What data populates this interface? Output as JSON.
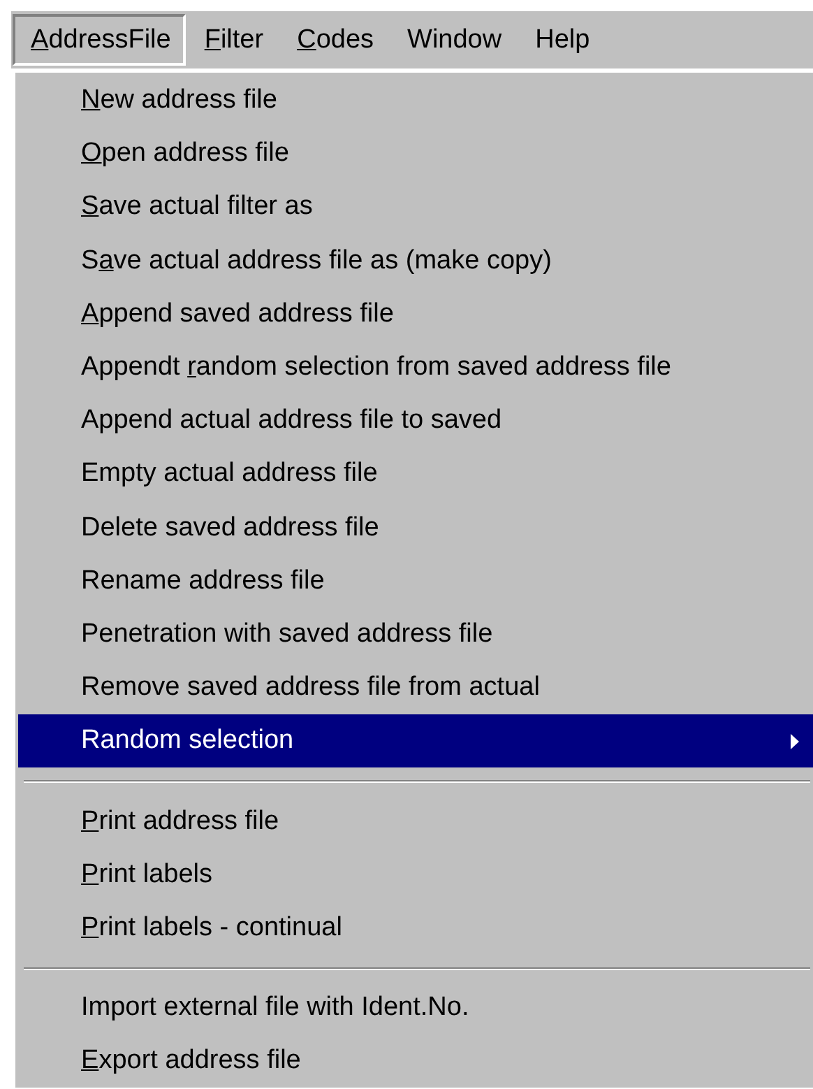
{
  "menubar": [
    {
      "label": {
        "key": "A",
        "post": "ddressFile"
      },
      "selected": true
    },
    {
      "label": {
        "key": "F",
        "post": "ilter"
      },
      "selected": false
    },
    {
      "label": {
        "key": "C",
        "post": "odes"
      },
      "selected": false
    },
    {
      "label": {
        "pre": "Window"
      },
      "selected": false
    },
    {
      "label": {
        "pre": "Help"
      },
      "selected": false
    }
  ],
  "menu": [
    {
      "kind": "item",
      "label": {
        "key": "N",
        "post": "ew address file"
      },
      "selected": false,
      "has_submenu": false
    },
    {
      "kind": "item",
      "label": {
        "key": "O",
        "post": "pen address file"
      },
      "selected": false,
      "has_submenu": false
    },
    {
      "kind": "item",
      "label": {
        "key": "S",
        "post": "ave actual filter as"
      },
      "selected": false,
      "has_submenu": false
    },
    {
      "kind": "item",
      "label": {
        "pre": "S",
        "key": "a",
        "post": "ve actual address file as (make copy)"
      },
      "selected": false,
      "has_submenu": false
    },
    {
      "kind": "item",
      "label": {
        "key": "A",
        "post": "ppend saved address file"
      },
      "selected": false,
      "has_submenu": false
    },
    {
      "kind": "item",
      "label": {
        "pre": "Appendt ",
        "key": "r",
        "post": "andom selection from saved address file"
      },
      "selected": false,
      "has_submenu": false
    },
    {
      "kind": "item",
      "label": {
        "pre": "Append actual address file to saved"
      },
      "selected": false,
      "has_submenu": false
    },
    {
      "kind": "item",
      "label": {
        "pre": "Empty actual address file"
      },
      "selected": false,
      "has_submenu": false
    },
    {
      "kind": "item",
      "label": {
        "pre": "Delete saved address file"
      },
      "selected": false,
      "has_submenu": false
    },
    {
      "kind": "item",
      "label": {
        "pre": "Rename address file"
      },
      "selected": false,
      "has_submenu": false
    },
    {
      "kind": "item",
      "label": {
        "pre": "Penetration with saved address file"
      },
      "selected": false,
      "has_submenu": false
    },
    {
      "kind": "item",
      "label": {
        "pre": "Remove saved address file from actual"
      },
      "selected": false,
      "has_submenu": false
    },
    {
      "kind": "item",
      "label": {
        "pre": "Random selection"
      },
      "selected": true,
      "has_submenu": true
    },
    {
      "kind": "separator"
    },
    {
      "kind": "item",
      "label": {
        "key": "P",
        "post": "rint address file"
      },
      "selected": false,
      "has_submenu": false
    },
    {
      "kind": "item",
      "label": {
        "key": "P",
        "post": "rint labels"
      },
      "selected": false,
      "has_submenu": false
    },
    {
      "kind": "item",
      "label": {
        "key": "P",
        "post": "rint labels - continual"
      },
      "selected": false,
      "has_submenu": false
    },
    {
      "kind": "separator"
    },
    {
      "kind": "item",
      "label": {
        "pre": "Import external file with Ident.No."
      },
      "selected": false,
      "has_submenu": false
    },
    {
      "kind": "item",
      "label": {
        "key": "E",
        "post": "xport address file"
      },
      "selected": false,
      "has_submenu": false
    }
  ]
}
